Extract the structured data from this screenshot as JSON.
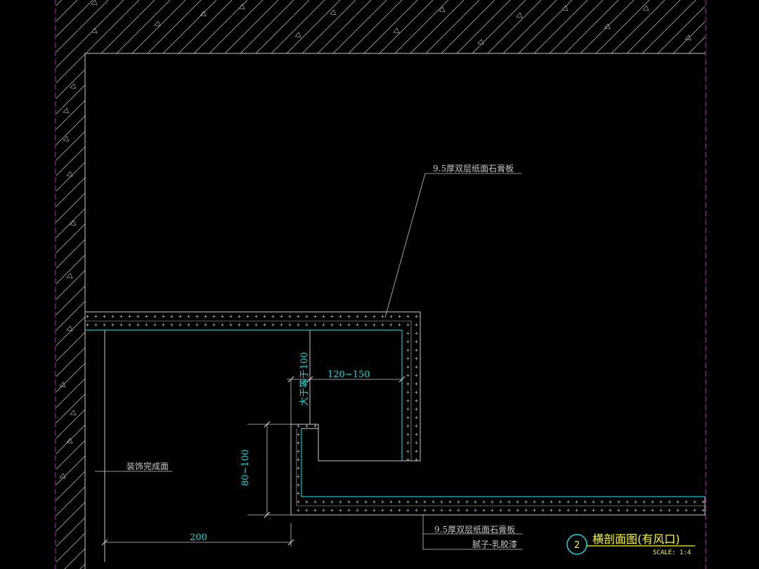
{
  "colors": {
    "background": "#000000",
    "line": "#c8c8c8",
    "board": "#00c8d0",
    "dimension": "#00e0e0",
    "boundary": "#c020c0",
    "title": "#ffff00"
  },
  "annotations": {
    "top_board_note": "9.5厚双层纸面石膏板",
    "bottom_board_note": "9.5厚双层纸面石膏板",
    "paint_note": "腻子-乳胶漆",
    "finish_surface_note": "装饰完成面"
  },
  "dimensions": {
    "vertical_min": "大于等于100",
    "horizontal_range": "120~150",
    "vent_height": "80~100",
    "left_offset": "200"
  },
  "title_block": {
    "number": "2",
    "title": "横剖面图(有风口)",
    "scale": "SCALE: 1:4"
  }
}
